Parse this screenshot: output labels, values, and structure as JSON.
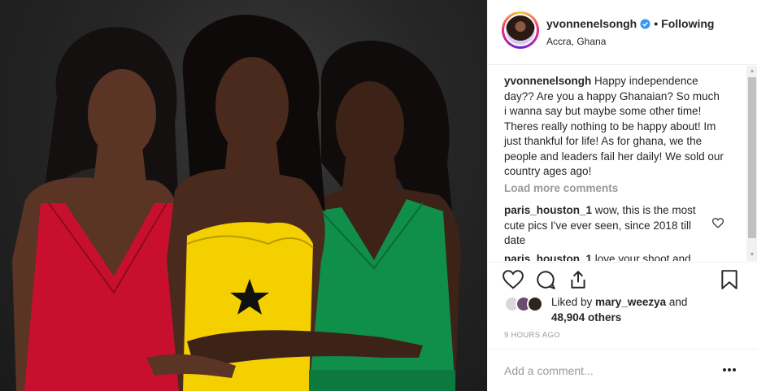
{
  "post": {
    "photo_alt": "Three women in red, yellow and green dresses"
  },
  "header": {
    "username": "yvonnenelsongh",
    "verified_icon": "verified-badge-icon",
    "separator": "•",
    "follow_status": "Following",
    "location": "Accra, Ghana"
  },
  "caption": {
    "username": "yvonnenelsongh",
    "text": "Happy independence day?? Are you a happy Ghanaian? So much i wanna say but maybe some other time! Theres really nothing to be happy about! Im just thankful for life! As for ghana, we the people and leaders fail her daily! We sold our country ages ago!"
  },
  "load_more_label": "Load more comments",
  "comments": [
    {
      "username": "paris_houston_1",
      "text": "wow, this is the most cute pics I've ever seen, since 2018 till date"
    },
    {
      "username": "paris_houston_1",
      "text": "love your shoot and"
    }
  ],
  "actions": {
    "like_icon": "heart-icon",
    "comment_icon": "comment-icon",
    "share_icon": "share-icon",
    "save_icon": "bookmark-icon"
  },
  "likes": {
    "prefix": "Liked by ",
    "user": "mary_weezya",
    "and": " and",
    "count": "48,904 others"
  },
  "timestamp": "9 HOURS AGO",
  "add_comment": {
    "placeholder": "Add a comment...",
    "more_icon": "more-options-icon"
  },
  "colors": {
    "red_dress": "#c8102e",
    "yellow_dress": "#f5d000",
    "green_dress": "#0f8f4a",
    "verified_blue": "#3897f0"
  }
}
